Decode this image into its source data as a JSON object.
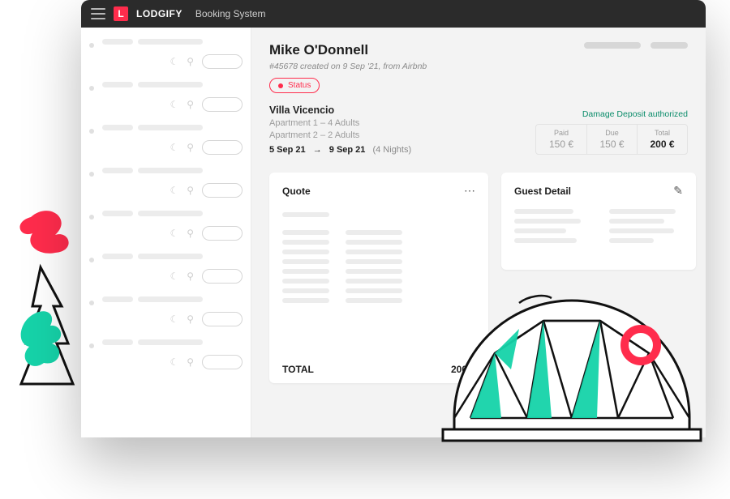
{
  "titlebar": {
    "brand": "LODGIFY",
    "section": "Booking System"
  },
  "header": {
    "guest_name": "Mike O'Donnell",
    "meta": "#45678 created on 9 Sep '21, from Airbnb",
    "status_label": "Status"
  },
  "property": {
    "name": "Villa Vicencio",
    "apt1": "Apartment 1 – 4 Adults",
    "apt2": "Apartment 2 – 2 Adults",
    "date_from": "5 Sep 21",
    "date_to": "9 Sep 21",
    "nights": "(4 Nights)"
  },
  "finance": {
    "damage_label": "Damage Deposit authorized",
    "paid_label": "Paid",
    "paid_value": "150 €",
    "due_label": "Due",
    "due_value": "150 €",
    "total_label": "Total",
    "total_value": "200 €"
  },
  "cards": {
    "quote_title": "Quote",
    "quote_total_label": "TOTAL",
    "quote_total_value": "200 €",
    "guest_title": "Guest Detail"
  },
  "colors": {
    "accent_red": "#ff2c4c",
    "teal": "#16d3a9",
    "text_muted": "#8a8a8a"
  }
}
